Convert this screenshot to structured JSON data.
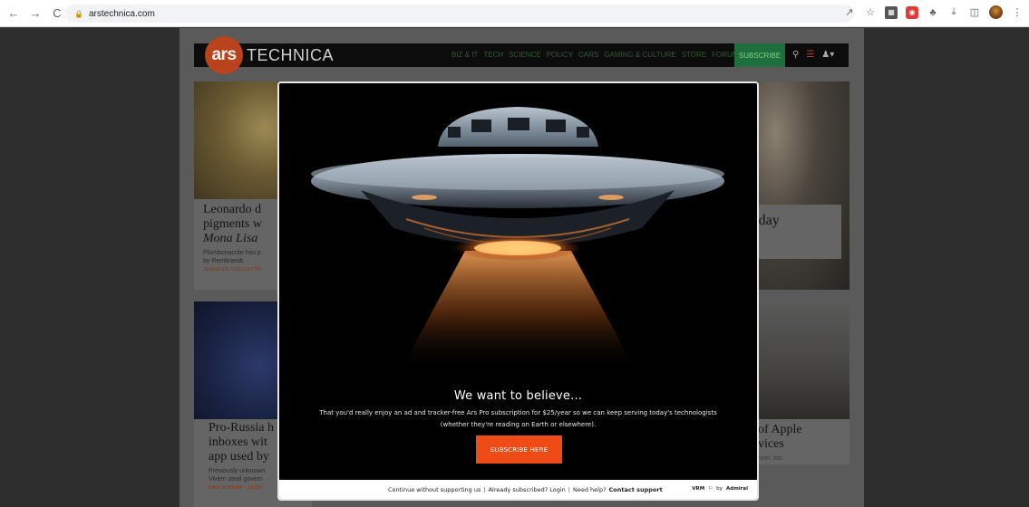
{
  "browser": {
    "url": "arstechnica.com",
    "nav": {
      "back": "←",
      "forward": "→",
      "reload": "C"
    },
    "toolbar_icons": [
      "share-icon",
      "star-icon",
      "extension-icon",
      "ublock-icon",
      "puzzle-icon",
      "download-icon",
      "sidepanel-icon",
      "profile-avatar",
      "menu-icon"
    ]
  },
  "ars": {
    "logo": "ars",
    "wordmark": "TECHNICA",
    "nav": [
      "BIZ & IT",
      "TECH",
      "SCIENCE",
      "POLICY",
      "CARS",
      "GAMING & CULTURE",
      "STORE",
      "FORUMS"
    ],
    "subscribe": "SUBSCRIBE",
    "colors": {
      "logo": "#b8431c",
      "subscribe": "#1e6f3b"
    }
  },
  "articles": [
    {
      "headline_lines": [
        "Leonardo d",
        "pigments w"
      ],
      "headline_italic": "Mona Lisa",
      "dek": [
        "Plumbonacrite has p",
        "by Rembrandt."
      ],
      "byline": "JENNIFER OUELLETTE -"
    },
    {
      "headline_lines": [
        "rn-day"
      ]
    },
    {
      "headline_lines": [
        "Pro-Russia h",
        "inboxes wit",
        "app used by"
      ],
      "dek": [
        "Previously unknown",
        "Vivern steal govern"
      ],
      "byline": "DAN GOODIN - 10/25/"
    },
    {
      "headline_lines": [
        "of Apple",
        "vices"
      ],
      "dek": [
        "ncer, too."
      ]
    }
  ],
  "modal": {
    "title": "We want to believe...",
    "body_line1": "That you'd really enjoy an ad and tracker-free Ars Pro subscription for $25/year so we can keep serving today's technologists",
    "body_line2": "(whether they're reading on Earth or elsewhere).",
    "cta": "SUBSCRIBE HERE",
    "footer": {
      "continue": "Continue without supporting us",
      "already": "Already subscribed? Login",
      "help": "Need help?",
      "contact": "Contact support",
      "vrm": "VRM",
      "by": "by",
      "admiral": "Admiral"
    },
    "colors": {
      "cta": "#ee4b17"
    }
  }
}
